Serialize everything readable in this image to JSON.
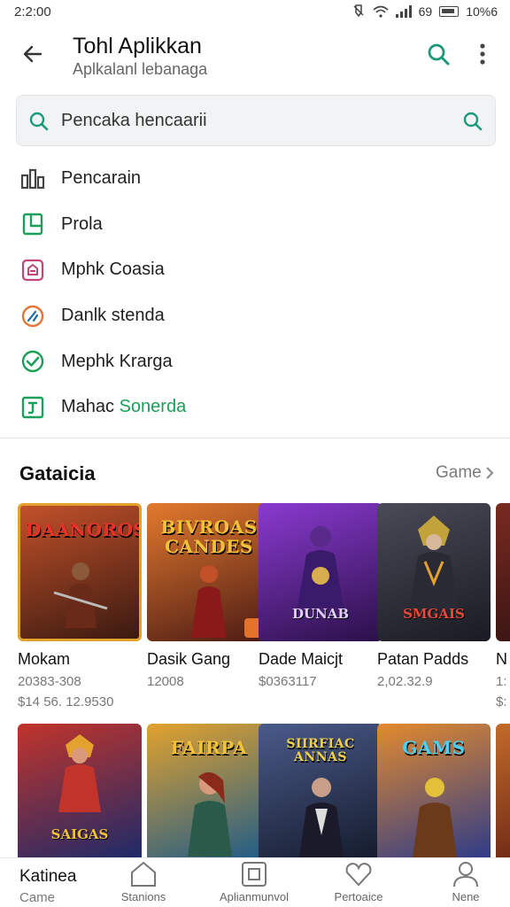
{
  "status_bar": {
    "time": "2:2:00",
    "signal_text": "69",
    "battery_text": "10%6"
  },
  "header": {
    "title": "Tohl Aplikkan",
    "subtitle": "Aplkalanl lebanaga"
  },
  "search": {
    "value": "Pencaka hencaarii",
    "placeholder": "Pencaka hencaarii"
  },
  "menu": {
    "items": [
      {
        "label": "Pencarain",
        "icon": "apps-icon",
        "color": "#444444"
      },
      {
        "label": "Prola",
        "icon": "phone-icon",
        "color": "#1aa05a"
      },
      {
        "label": "Mphk Coasia",
        "icon": "store-icon",
        "color": "#c2457a"
      },
      {
        "label": "Danlk stenda",
        "icon": "speed-icon",
        "color": "#e2763a"
      },
      {
        "label": "Mephk Krarga",
        "icon": "check-circle-icon",
        "color": "#1aa05a"
      },
      {
        "label": "Mahac",
        "label_highlight": "Sonerda",
        "icon": "box-icon",
        "color": "#1aa05a"
      }
    ]
  },
  "section": {
    "title": "Gataicia",
    "more_label": "Game"
  },
  "games_row1": [
    {
      "name": "Mokam",
      "meta1": "20383-308",
      "meta2": "$14 56. 12.9530",
      "thumb_title": "DAANOROS",
      "thumb_sub": "",
      "bg1": "#3a1a10",
      "bg2": "#c2512a",
      "title_color": "#e8322a"
    },
    {
      "name": "Dasik Gang",
      "meta1": "12008",
      "meta2": "",
      "thumb_title": "BIVROAS CANDES",
      "thumb_sub": "",
      "bg1": "#4a1a14",
      "bg2": "#e37a2e",
      "title_color": "#f2c13a"
    },
    {
      "name": "Dade Maicjt",
      "meta1": "$0363117",
      "meta2": "",
      "thumb_title": "",
      "thumb_sub": "DUNAB",
      "bg1": "#2a1048",
      "bg2": "#8a3ad0",
      "title_color": "#e0d0ff"
    },
    {
      "name": "Patan Padds",
      "meta1": "2,02.32.9",
      "meta2": "",
      "thumb_title": "",
      "thumb_sub": "SMGAIS",
      "bg1": "#1a1a22",
      "bg2": "#4a4a58",
      "title_color": "#e84a3a"
    },
    {
      "name": "N",
      "meta1": "1:",
      "meta2": "$:",
      "thumb_title": "",
      "thumb_sub": "",
      "bg1": "#2a1010",
      "bg2": "#7a2a20",
      "title_color": "#ffffff"
    }
  ],
  "games_row2": [
    {
      "thumb_title": "",
      "thumb_sub": "SAIGAS",
      "bg1": "#1a2a6a",
      "bg2": "#c2342a",
      "title_color": "#f2c13a"
    },
    {
      "thumb_title": "FAIRPA",
      "thumb_sub": "",
      "bg1": "#1a5a8a",
      "bg2": "#e3a22e",
      "title_color": "#f2c13a"
    },
    {
      "thumb_title": "SIIRFIAC ANNAS",
      "thumb_sub": "",
      "bg1": "#141a2a",
      "bg2": "#4a5a8a",
      "title_color": "#f2d04a"
    },
    {
      "thumb_title": "GAMS",
      "thumb_sub": "",
      "bg1": "#2a3a8a",
      "bg2": "#e38a2e",
      "title_color": "#4ad0f2"
    },
    {
      "thumb_title": "",
      "thumb_sub": "",
      "bg1": "#5a1a10",
      "bg2": "#c26a2a",
      "title_color": "#ffffff"
    }
  ],
  "bottom_nav": {
    "first": {
      "line1": "Katinea",
      "line2": "Came"
    },
    "items": [
      {
        "label": "Stanions",
        "icon": "home-icon"
      },
      {
        "label": "Aplianmunvol",
        "icon": "apps-box-icon"
      },
      {
        "label": "Pertoaice",
        "icon": "heart-icon"
      },
      {
        "label": "Nene",
        "icon": "person-icon"
      }
    ]
  },
  "colors": {
    "accent": "#1aa05a",
    "search_icon": "#1a9a7a"
  }
}
